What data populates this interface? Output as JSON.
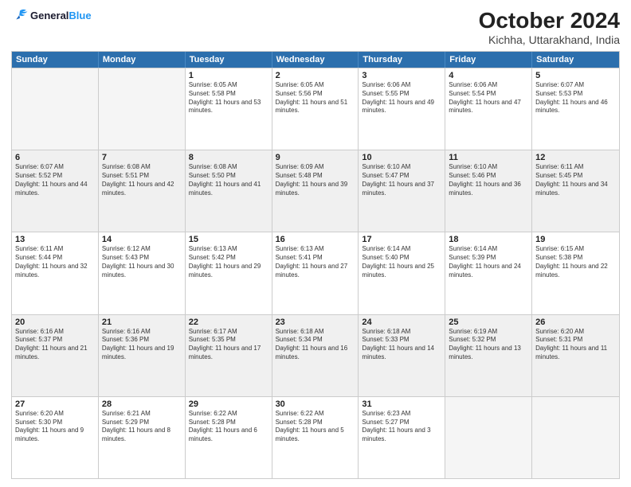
{
  "logo": {
    "line1": "General",
    "line2": "Blue"
  },
  "title": "October 2024",
  "subtitle": "Kichha, Uttarakhand, India",
  "header_days": [
    "Sunday",
    "Monday",
    "Tuesday",
    "Wednesday",
    "Thursday",
    "Friday",
    "Saturday"
  ],
  "rows": [
    [
      {
        "day": "",
        "sunrise": "",
        "sunset": "",
        "daylight": "",
        "empty": true
      },
      {
        "day": "",
        "sunrise": "",
        "sunset": "",
        "daylight": "",
        "empty": true
      },
      {
        "day": "1",
        "sunrise": "Sunrise: 6:05 AM",
        "sunset": "Sunset: 5:58 PM",
        "daylight": "Daylight: 11 hours and 53 minutes."
      },
      {
        "day": "2",
        "sunrise": "Sunrise: 6:05 AM",
        "sunset": "Sunset: 5:56 PM",
        "daylight": "Daylight: 11 hours and 51 minutes."
      },
      {
        "day": "3",
        "sunrise": "Sunrise: 6:06 AM",
        "sunset": "Sunset: 5:55 PM",
        "daylight": "Daylight: 11 hours and 49 minutes."
      },
      {
        "day": "4",
        "sunrise": "Sunrise: 6:06 AM",
        "sunset": "Sunset: 5:54 PM",
        "daylight": "Daylight: 11 hours and 47 minutes."
      },
      {
        "day": "5",
        "sunrise": "Sunrise: 6:07 AM",
        "sunset": "Sunset: 5:53 PM",
        "daylight": "Daylight: 11 hours and 46 minutes."
      }
    ],
    [
      {
        "day": "6",
        "sunrise": "Sunrise: 6:07 AM",
        "sunset": "Sunset: 5:52 PM",
        "daylight": "Daylight: 11 hours and 44 minutes."
      },
      {
        "day": "7",
        "sunrise": "Sunrise: 6:08 AM",
        "sunset": "Sunset: 5:51 PM",
        "daylight": "Daylight: 11 hours and 42 minutes."
      },
      {
        "day": "8",
        "sunrise": "Sunrise: 6:08 AM",
        "sunset": "Sunset: 5:50 PM",
        "daylight": "Daylight: 11 hours and 41 minutes."
      },
      {
        "day": "9",
        "sunrise": "Sunrise: 6:09 AM",
        "sunset": "Sunset: 5:48 PM",
        "daylight": "Daylight: 11 hours and 39 minutes."
      },
      {
        "day": "10",
        "sunrise": "Sunrise: 6:10 AM",
        "sunset": "Sunset: 5:47 PM",
        "daylight": "Daylight: 11 hours and 37 minutes."
      },
      {
        "day": "11",
        "sunrise": "Sunrise: 6:10 AM",
        "sunset": "Sunset: 5:46 PM",
        "daylight": "Daylight: 11 hours and 36 minutes."
      },
      {
        "day": "12",
        "sunrise": "Sunrise: 6:11 AM",
        "sunset": "Sunset: 5:45 PM",
        "daylight": "Daylight: 11 hours and 34 minutes."
      }
    ],
    [
      {
        "day": "13",
        "sunrise": "Sunrise: 6:11 AM",
        "sunset": "Sunset: 5:44 PM",
        "daylight": "Daylight: 11 hours and 32 minutes."
      },
      {
        "day": "14",
        "sunrise": "Sunrise: 6:12 AM",
        "sunset": "Sunset: 5:43 PM",
        "daylight": "Daylight: 11 hours and 30 minutes."
      },
      {
        "day": "15",
        "sunrise": "Sunrise: 6:13 AM",
        "sunset": "Sunset: 5:42 PM",
        "daylight": "Daylight: 11 hours and 29 minutes."
      },
      {
        "day": "16",
        "sunrise": "Sunrise: 6:13 AM",
        "sunset": "Sunset: 5:41 PM",
        "daylight": "Daylight: 11 hours and 27 minutes."
      },
      {
        "day": "17",
        "sunrise": "Sunrise: 6:14 AM",
        "sunset": "Sunset: 5:40 PM",
        "daylight": "Daylight: 11 hours and 25 minutes."
      },
      {
        "day": "18",
        "sunrise": "Sunrise: 6:14 AM",
        "sunset": "Sunset: 5:39 PM",
        "daylight": "Daylight: 11 hours and 24 minutes."
      },
      {
        "day": "19",
        "sunrise": "Sunrise: 6:15 AM",
        "sunset": "Sunset: 5:38 PM",
        "daylight": "Daylight: 11 hours and 22 minutes."
      }
    ],
    [
      {
        "day": "20",
        "sunrise": "Sunrise: 6:16 AM",
        "sunset": "Sunset: 5:37 PM",
        "daylight": "Daylight: 11 hours and 21 minutes."
      },
      {
        "day": "21",
        "sunrise": "Sunrise: 6:16 AM",
        "sunset": "Sunset: 5:36 PM",
        "daylight": "Daylight: 11 hours and 19 minutes."
      },
      {
        "day": "22",
        "sunrise": "Sunrise: 6:17 AM",
        "sunset": "Sunset: 5:35 PM",
        "daylight": "Daylight: 11 hours and 17 minutes."
      },
      {
        "day": "23",
        "sunrise": "Sunrise: 6:18 AM",
        "sunset": "Sunset: 5:34 PM",
        "daylight": "Daylight: 11 hours and 16 minutes."
      },
      {
        "day": "24",
        "sunrise": "Sunrise: 6:18 AM",
        "sunset": "Sunset: 5:33 PM",
        "daylight": "Daylight: 11 hours and 14 minutes."
      },
      {
        "day": "25",
        "sunrise": "Sunrise: 6:19 AM",
        "sunset": "Sunset: 5:32 PM",
        "daylight": "Daylight: 11 hours and 13 minutes."
      },
      {
        "day": "26",
        "sunrise": "Sunrise: 6:20 AM",
        "sunset": "Sunset: 5:31 PM",
        "daylight": "Daylight: 11 hours and 11 minutes."
      }
    ],
    [
      {
        "day": "27",
        "sunrise": "Sunrise: 6:20 AM",
        "sunset": "Sunset: 5:30 PM",
        "daylight": "Daylight: 11 hours and 9 minutes."
      },
      {
        "day": "28",
        "sunrise": "Sunrise: 6:21 AM",
        "sunset": "Sunset: 5:29 PM",
        "daylight": "Daylight: 11 hours and 8 minutes."
      },
      {
        "day": "29",
        "sunrise": "Sunrise: 6:22 AM",
        "sunset": "Sunset: 5:28 PM",
        "daylight": "Daylight: 11 hours and 6 minutes."
      },
      {
        "day": "30",
        "sunrise": "Sunrise: 6:22 AM",
        "sunset": "Sunset: 5:28 PM",
        "daylight": "Daylight: 11 hours and 5 minutes."
      },
      {
        "day": "31",
        "sunrise": "Sunrise: 6:23 AM",
        "sunset": "Sunset: 5:27 PM",
        "daylight": "Daylight: 11 hours and 3 minutes."
      },
      {
        "day": "",
        "sunrise": "",
        "sunset": "",
        "daylight": "",
        "empty": true
      },
      {
        "day": "",
        "sunrise": "",
        "sunset": "",
        "daylight": "",
        "empty": true
      }
    ]
  ]
}
